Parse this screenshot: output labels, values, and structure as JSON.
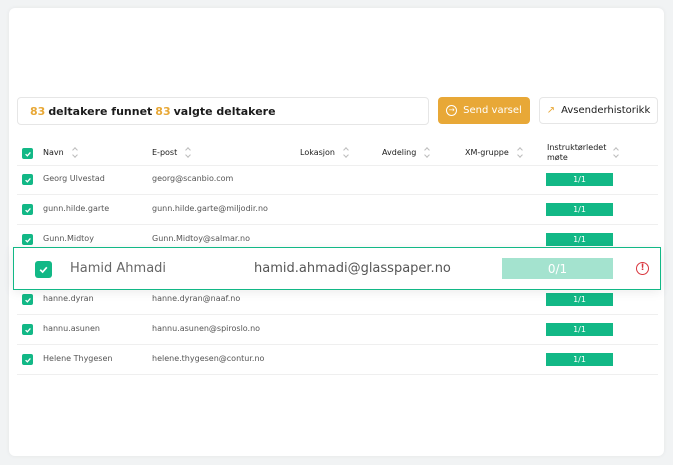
{
  "summary": {
    "found_count": "83",
    "found_text": "deltakere funnet",
    "selected_count": "83",
    "selected_text": "valgte deltakere"
  },
  "actions": {
    "send_label": "Send varsel",
    "history_label": "Avsenderhistorikk"
  },
  "table": {
    "headers": {
      "name": "Navn",
      "email": "E-post",
      "location": "Lokasjon",
      "department": "Avdeling",
      "xm_group": "XM-gruppe",
      "instructor_meeting": "Instruktørledet møte"
    },
    "rows": [
      {
        "name": "Georg Ulvestad",
        "email": "georg@scanbio.com",
        "meeting": "1/1"
      },
      {
        "name": "gunn.hilde.garte",
        "email": "gunn.hilde.garte@miljodir.no",
        "meeting": "1/1"
      },
      {
        "name": "Gunn.Midtoy",
        "email": "Gunn.Midtoy@salmar.no",
        "meeting": "1/1"
      },
      {
        "name": "",
        "email": "",
        "meeting": ""
      },
      {
        "name": "hanne.dyran",
        "email": "hanne.dyran@naaf.no",
        "meeting": "1/1"
      },
      {
        "name": "hannu.asunen",
        "email": "hannu.asunen@spiroslo.no",
        "meeting": "1/1"
      },
      {
        "name": "Helene Thygesen",
        "email": "helene.thygesen@contur.no",
        "meeting": "1/1"
      }
    ]
  },
  "highlight_row": {
    "name": "Hamid Ahmadi",
    "email": "hamid.ahmadi@glasspaper.no",
    "meeting": "0/1"
  },
  "colors": {
    "accent": "#e8a837",
    "success": "#12b886",
    "success_light": "#a4e3cf",
    "error": "#d9363e"
  },
  "icons": {
    "send": "arrow-circle-right-icon",
    "history": "trend-arrow-icon",
    "warning": "alert-circle-icon"
  }
}
